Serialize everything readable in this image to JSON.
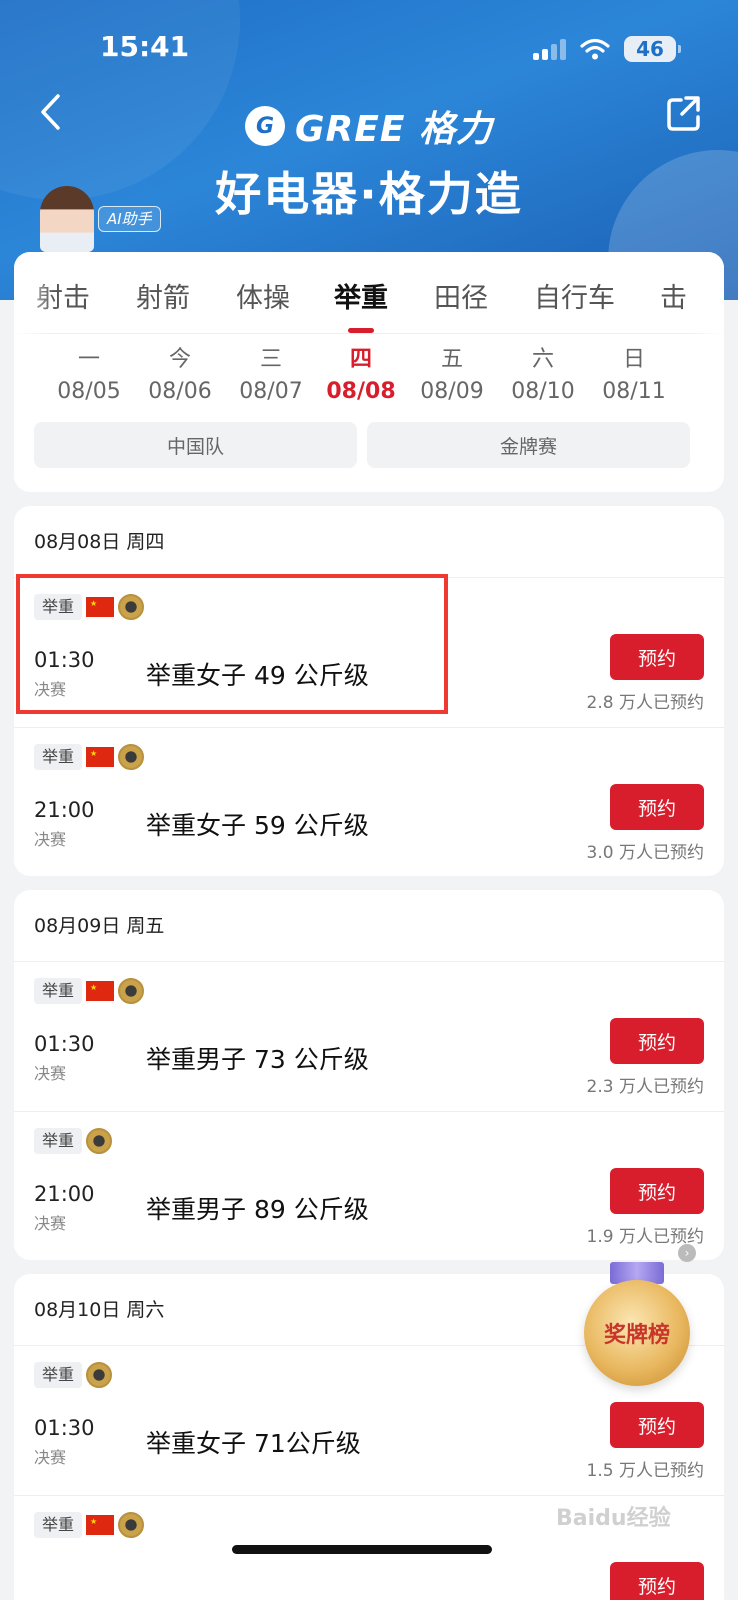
{
  "status_bar": {
    "time": "15:41",
    "battery": "46"
  },
  "header": {
    "logo_mark": "G",
    "brand": "GREE 格力",
    "slogan": "好电器·格力造",
    "ai_label": "AI助手"
  },
  "sport_tabs": [
    "射击",
    "射箭",
    "体操",
    "举重",
    "田径",
    "自行车",
    "击"
  ],
  "active_sport": "举重",
  "days": [
    {
      "weekday": "一",
      "date": "08/05"
    },
    {
      "weekday": "今",
      "date": "08/06"
    },
    {
      "weekday": "三",
      "date": "08/07"
    },
    {
      "weekday": "四",
      "date": "08/08"
    },
    {
      "weekday": "五",
      "date": "08/09"
    },
    {
      "weekday": "六",
      "date": "08/10"
    },
    {
      "weekday": "日",
      "date": "08/11"
    }
  ],
  "filters": [
    "中国队",
    "金牌赛"
  ],
  "groups": [
    {
      "date_label": "08月08日 周四",
      "events": [
        {
          "sport": "举重",
          "china": true,
          "time": "01:30",
          "stage": "决赛",
          "title": "举重女子 49 公斤级",
          "button": "预约",
          "count": "2.8 万人已预约"
        },
        {
          "sport": "举重",
          "china": true,
          "time": "21:00",
          "stage": "决赛",
          "title": "举重女子 59 公斤级",
          "button": "预约",
          "count": "3.0 万人已预约"
        }
      ]
    },
    {
      "date_label": "08月09日 周五",
      "events": [
        {
          "sport": "举重",
          "china": true,
          "time": "01:30",
          "stage": "决赛",
          "title": "举重男子 73 公斤级",
          "button": "预约",
          "count": "2.3 万人已预约"
        },
        {
          "sport": "举重",
          "china": false,
          "time": "21:00",
          "stage": "决赛",
          "title": "举重男子 89 公斤级",
          "button": "预约",
          "count": "1.9 万人已预约"
        }
      ]
    },
    {
      "date_label": "08月10日 周六",
      "events": [
        {
          "sport": "举重",
          "china": false,
          "time": "01:30",
          "stage": "决赛",
          "title": "举重女子 71公斤级",
          "button": "预约",
          "count": "1.5 万人已预约"
        },
        {
          "sport": "举重",
          "china": true,
          "time": "",
          "stage": "",
          "title": "",
          "button": "预约",
          "count": ""
        }
      ]
    }
  ],
  "medal_badge": "奖牌榜",
  "watermark": "Baidu经验",
  "colors": {
    "accent": "#d81e2c",
    "header_blue": "#1e6fc6"
  }
}
